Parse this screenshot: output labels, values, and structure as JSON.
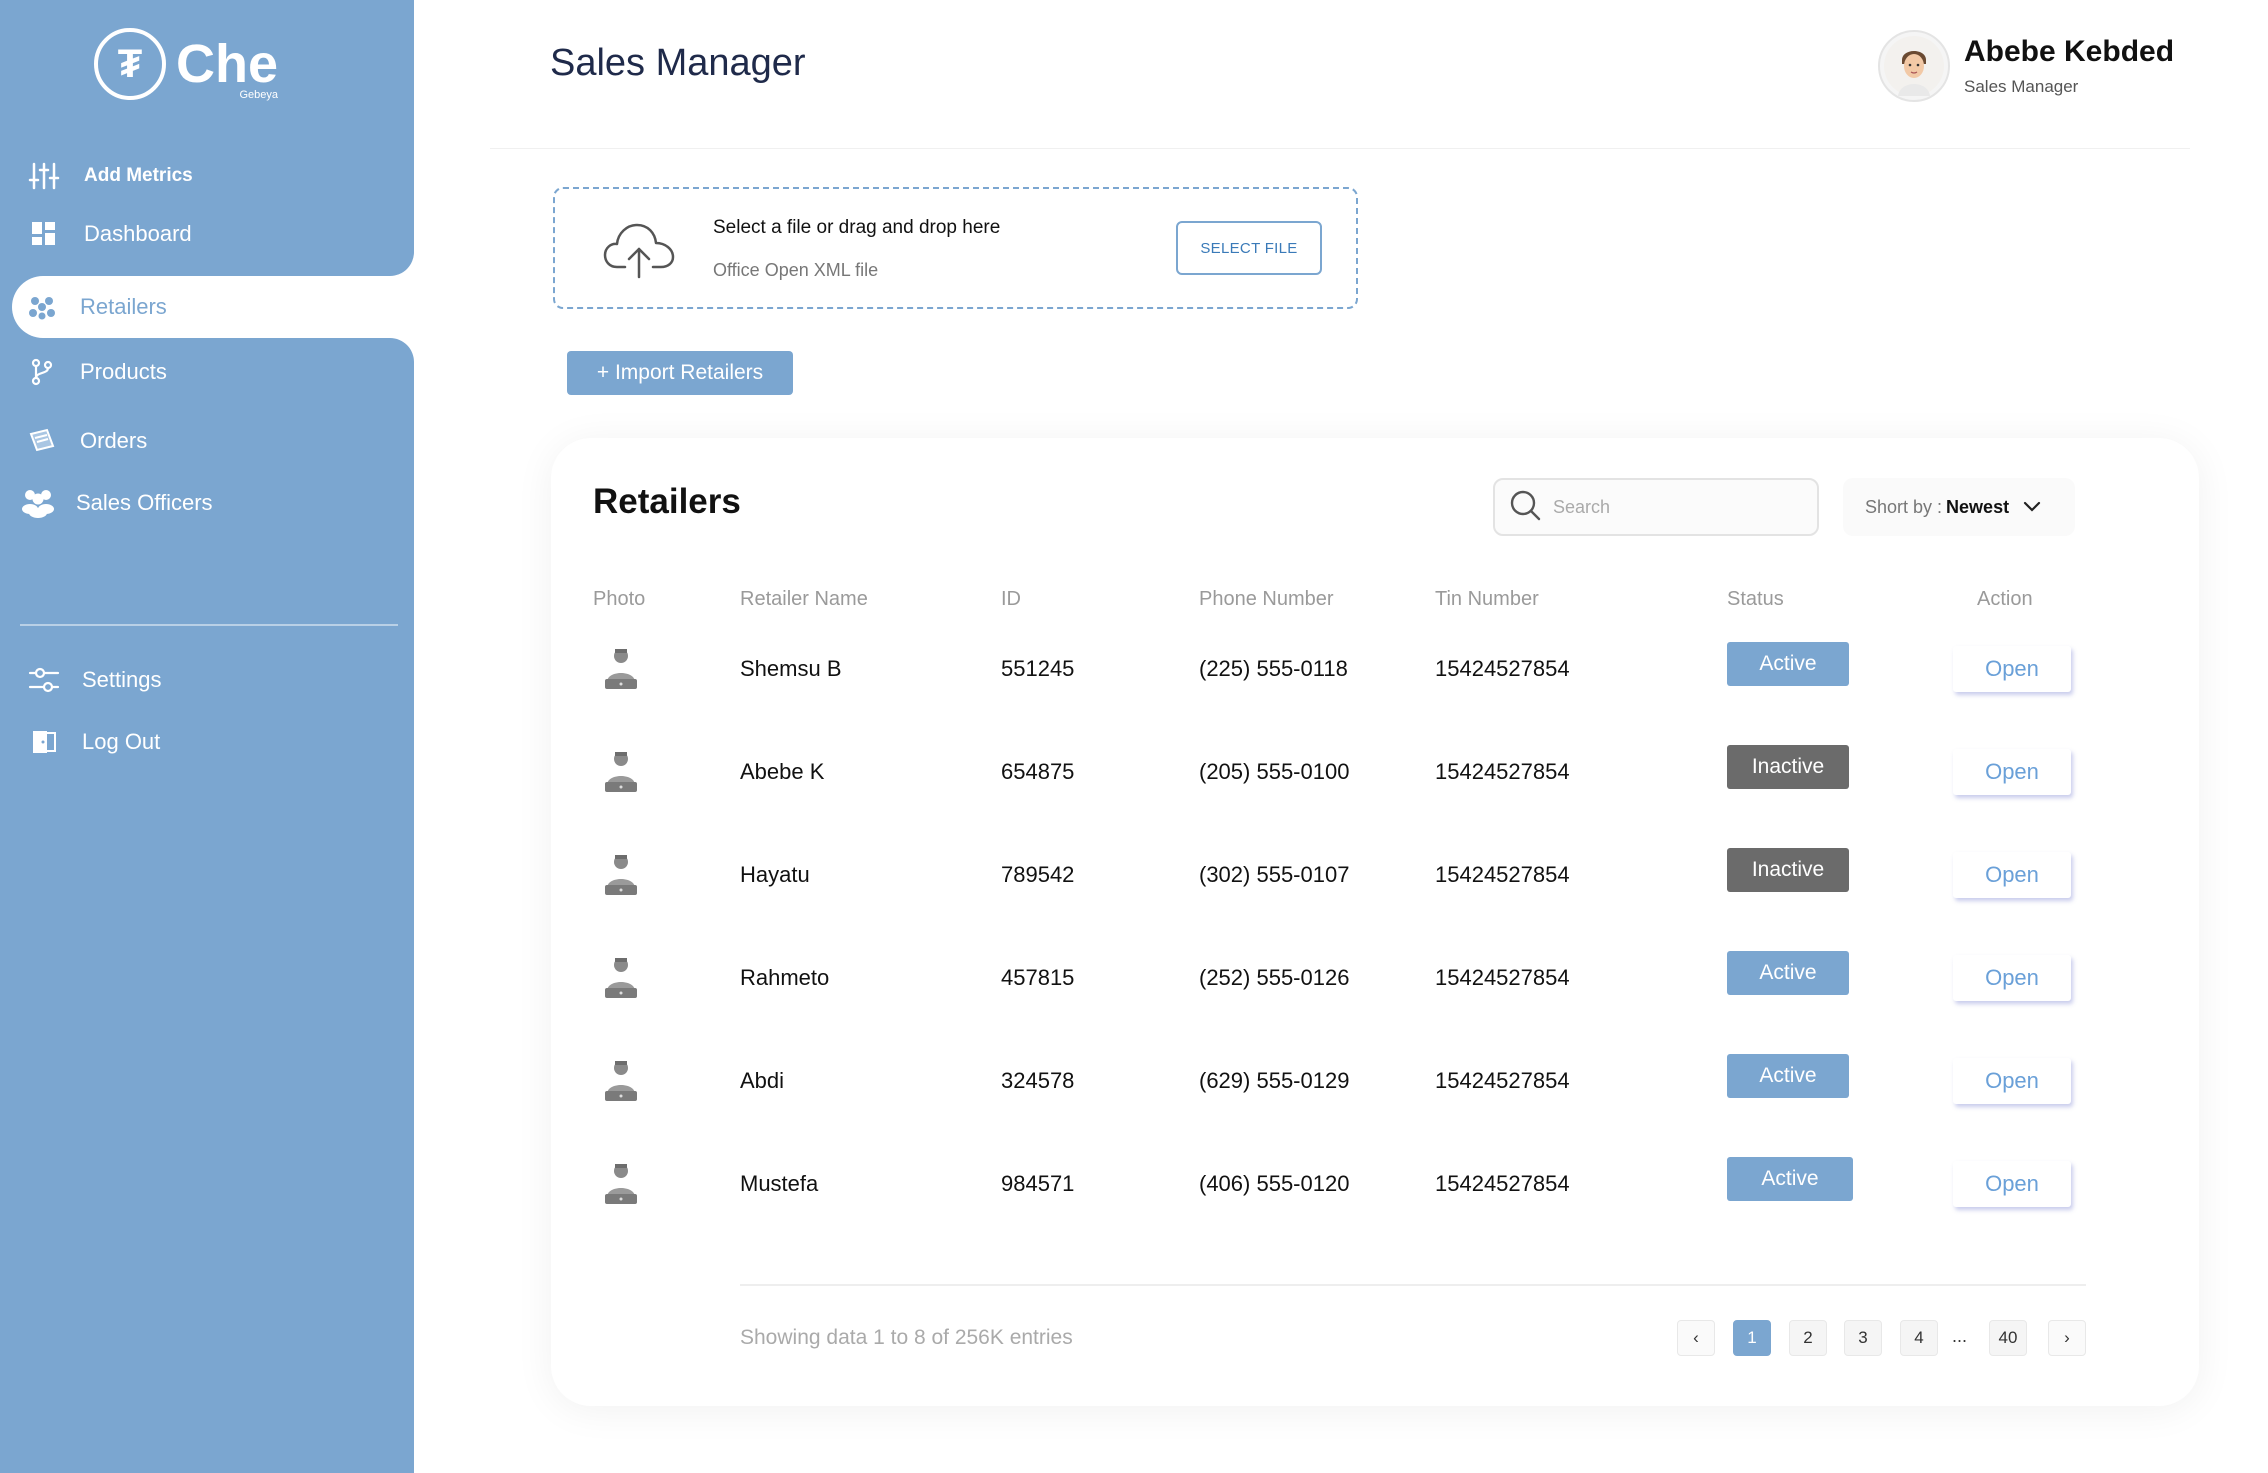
{
  "app": {
    "logo_text": "Che",
    "logo_sub": "Gebeya",
    "logo_mark": "₮",
    "accent": "#7ba6d0"
  },
  "sidebar": {
    "items": [
      {
        "label": "Add Metrics",
        "icon": "sliders-icon"
      },
      {
        "label": "Dashboard",
        "icon": "grid-icon"
      },
      {
        "label": "Retailers",
        "icon": "users-dots-icon",
        "active": true
      },
      {
        "label": "Products",
        "icon": "branch-icon"
      },
      {
        "label": "Orders",
        "icon": "tag-icon"
      },
      {
        "label": "Sales Officers",
        "icon": "people-icon"
      }
    ],
    "bottom_items": [
      {
        "label": "Settings",
        "icon": "settings-sliders-icon"
      },
      {
        "label": "Log Out",
        "icon": "logout-door-icon"
      }
    ]
  },
  "header": {
    "title": "Sales Manager",
    "user_name": "Abebe Kebded",
    "user_role": "Sales Manager"
  },
  "upload": {
    "main_text": "Select a file or drag and drop here",
    "sub_text": "Office Open XML file",
    "button_label": "SELECT FILE"
  },
  "import_button": "+ Import Retailers",
  "retailers": {
    "title": "Retailers",
    "search_placeholder": "Search",
    "sort_prefix": "Short by : ",
    "sort_value": "Newest",
    "columns": [
      "Photo",
      "Retailer Name",
      "ID",
      "Phone Number",
      "Tin Number",
      "Status",
      "Action"
    ],
    "rows": [
      {
        "name": "Shemsu B",
        "id": "551245",
        "phone": "(225) 555-0118",
        "tin": "15424527854",
        "status": "Active",
        "action": "Open"
      },
      {
        "name": "Abebe K",
        "id": "654875",
        "phone": "(205) 555-0100",
        "tin": "15424527854",
        "status": "Inactive",
        "action": "Open"
      },
      {
        "name": "Hayatu",
        "id": "789542",
        "phone": "(302) 555-0107",
        "tin": "15424527854",
        "status": "Inactive",
        "action": "Open"
      },
      {
        "name": "Rahmeto",
        "id": "457815",
        "phone": "(252) 555-0126",
        "tin": "15424527854",
        "status": "Active",
        "action": "Open"
      },
      {
        "name": "Abdi",
        "id": "324578",
        "phone": "(629) 555-0129",
        "tin": "15424527854",
        "status": "Active",
        "action": "Open"
      },
      {
        "name": "Mustefa",
        "id": "984571",
        "phone": "(406) 555-0120",
        "tin": "15424527854",
        "status": "Active",
        "action": "Open"
      }
    ],
    "showing_text": "Showing data 1 to 8 of  256K entries",
    "pagination": {
      "prev": "‹",
      "pages": [
        "1",
        "2",
        "3",
        "4"
      ],
      "ellipsis": "...",
      "last": "40",
      "next": "›",
      "current": "1"
    }
  }
}
